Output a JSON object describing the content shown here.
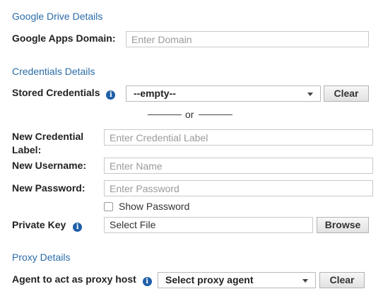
{
  "google_drive": {
    "section_title": "Google Drive Details",
    "domain_label": "Google Apps Domain:",
    "domain_placeholder": "Enter Domain",
    "domain_value": ""
  },
  "credentials": {
    "section_title": "Credentials Details",
    "stored_label": "Stored Credentials",
    "stored_value": "--empty--",
    "clear_label": "Clear",
    "or_label": "or",
    "new_label_line1": "New Credential",
    "new_label_line2": "Label:",
    "new_label_placeholder": "Enter Credential Label",
    "username_label": "New Username:",
    "username_placeholder": "Enter Name",
    "password_label": "New Password:",
    "password_placeholder": "Enter Password",
    "show_password_label": "Show Password",
    "show_password_checked": false,
    "private_key_label": "Private Key",
    "private_key_value": "Select File",
    "browse_label": "Browse"
  },
  "proxy": {
    "section_title": "Proxy Details",
    "agent_label": "Agent to act as proxy host",
    "agent_value": "Select proxy agent",
    "clear_label": "Clear"
  },
  "icons": {
    "info_glyph": "i",
    "info_color": "#1f5fa8",
    "section_color": "#2a6ca8"
  }
}
